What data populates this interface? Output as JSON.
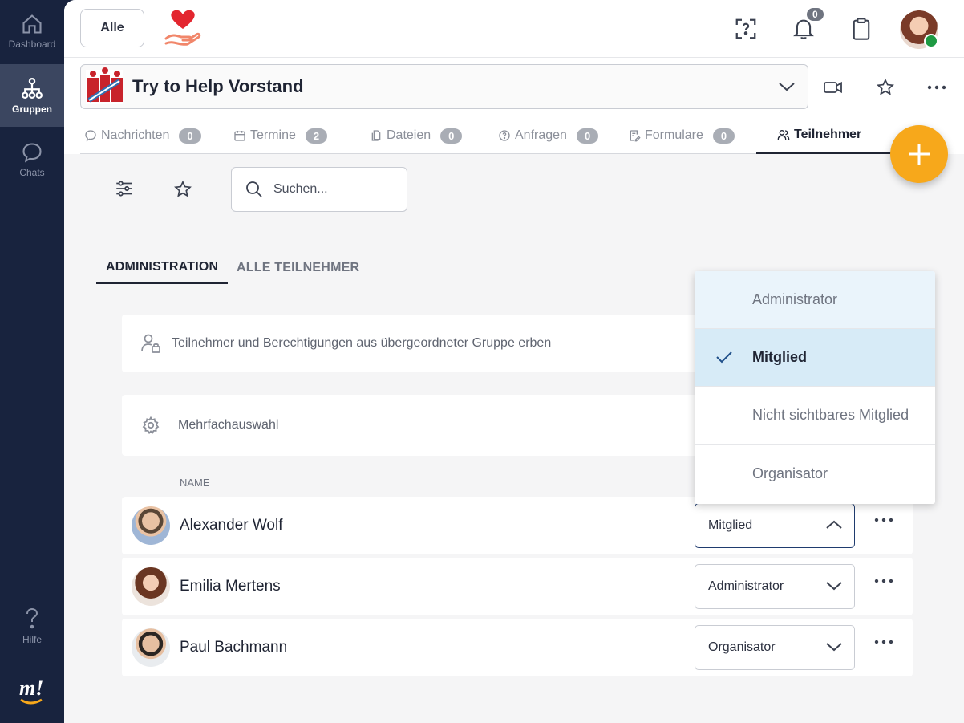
{
  "sidebar": {
    "items": [
      {
        "label": "Dashboard",
        "icon": "home-icon"
      },
      {
        "label": "Gruppen",
        "icon": "groups-icon"
      },
      {
        "label": "Chats",
        "icon": "chat-icon"
      }
    ],
    "help_label": "Hilfe",
    "logo_text": "m!"
  },
  "topbar": {
    "alle_label": "Alle",
    "notification_count": "0"
  },
  "group": {
    "title": "Try to Help Vorstand"
  },
  "tabs": [
    {
      "label": "Nachrichten",
      "count": "0"
    },
    {
      "label": "Termine",
      "count": "2"
    },
    {
      "label": "Dateien",
      "count": "0"
    },
    {
      "label": "Anfragen",
      "count": "0"
    },
    {
      "label": "Formulare",
      "count": "0"
    },
    {
      "label": "Teilnehmer"
    }
  ],
  "search": {
    "placeholder": "Suchen..."
  },
  "subtabs": [
    "ADMINISTRATION",
    "ALLE TEILNEHMER"
  ],
  "inherit_text": "Teilnehmer und Berechtigungen aus übergeordneter Gruppe erben",
  "multiselect_text": "Mehrfachauswahl",
  "column_name": "NAME",
  "members": [
    {
      "name": "Alexander Wolf",
      "role": "Mitglied"
    },
    {
      "name": "Emilia Mertens",
      "role": "Administrator"
    },
    {
      "name": "Paul Bachmann",
      "role": "Organisator"
    }
  ],
  "dropdown": {
    "options": [
      "Administrator",
      "Mitglied",
      "Nicht sichtbares Mitglied",
      "Organisator"
    ],
    "selected": "Mitglied"
  },
  "colors": {
    "accent": "#f7a81b",
    "sidebar": "#18233e",
    "selected": "#d7ebf7"
  }
}
